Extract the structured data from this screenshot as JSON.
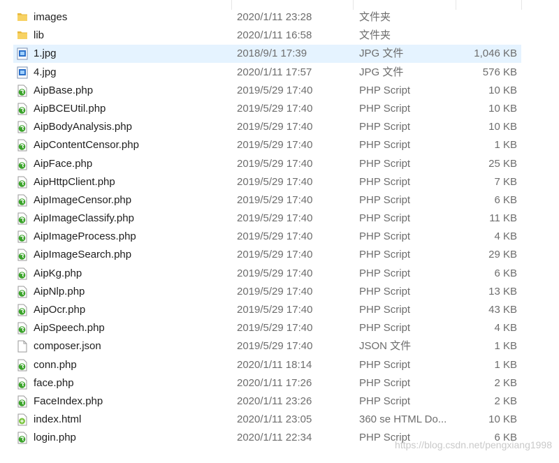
{
  "rows": [
    {
      "name": "images",
      "date": "2020/1/11 23:28",
      "type": "文件夹",
      "size": "",
      "icon": "folder-icon"
    },
    {
      "name": "lib",
      "date": "2020/1/11 16:58",
      "type": "文件夹",
      "size": "",
      "icon": "folder-icon"
    },
    {
      "name": "1.jpg",
      "date": "2018/9/1 17:39",
      "type": "JPG 文件",
      "size": "1,046 KB",
      "icon": "jpg-file-icon",
      "selected": true
    },
    {
      "name": "4.jpg",
      "date": "2020/1/11 17:57",
      "type": "JPG 文件",
      "size": "576 KB",
      "icon": "jpg-file-icon"
    },
    {
      "name": "AipBase.php",
      "date": "2019/5/29 17:40",
      "type": "PHP Script",
      "size": "10 KB",
      "icon": "php-file-icon"
    },
    {
      "name": "AipBCEUtil.php",
      "date": "2019/5/29 17:40",
      "type": "PHP Script",
      "size": "10 KB",
      "icon": "php-file-icon"
    },
    {
      "name": "AipBodyAnalysis.php",
      "date": "2019/5/29 17:40",
      "type": "PHP Script",
      "size": "10 KB",
      "icon": "php-file-icon"
    },
    {
      "name": "AipContentCensor.php",
      "date": "2019/5/29 17:40",
      "type": "PHP Script",
      "size": "1 KB",
      "icon": "php-file-icon"
    },
    {
      "name": "AipFace.php",
      "date": "2019/5/29 17:40",
      "type": "PHP Script",
      "size": "25 KB",
      "icon": "php-file-icon"
    },
    {
      "name": "AipHttpClient.php",
      "date": "2019/5/29 17:40",
      "type": "PHP Script",
      "size": "7 KB",
      "icon": "php-file-icon"
    },
    {
      "name": "AipImageCensor.php",
      "date": "2019/5/29 17:40",
      "type": "PHP Script",
      "size": "6 KB",
      "icon": "php-file-icon"
    },
    {
      "name": "AipImageClassify.php",
      "date": "2019/5/29 17:40",
      "type": "PHP Script",
      "size": "11 KB",
      "icon": "php-file-icon"
    },
    {
      "name": "AipImageProcess.php",
      "date": "2019/5/29 17:40",
      "type": "PHP Script",
      "size": "4 KB",
      "icon": "php-file-icon"
    },
    {
      "name": "AipImageSearch.php",
      "date": "2019/5/29 17:40",
      "type": "PHP Script",
      "size": "29 KB",
      "icon": "php-file-icon"
    },
    {
      "name": "AipKg.php",
      "date": "2019/5/29 17:40",
      "type": "PHP Script",
      "size": "6 KB",
      "icon": "php-file-icon"
    },
    {
      "name": "AipNlp.php",
      "date": "2019/5/29 17:40",
      "type": "PHP Script",
      "size": "13 KB",
      "icon": "php-file-icon"
    },
    {
      "name": "AipOcr.php",
      "date": "2019/5/29 17:40",
      "type": "PHP Script",
      "size": "43 KB",
      "icon": "php-file-icon"
    },
    {
      "name": "AipSpeech.php",
      "date": "2019/5/29 17:40",
      "type": "PHP Script",
      "size": "4 KB",
      "icon": "php-file-icon"
    },
    {
      "name": "composer.json",
      "date": "2019/5/29 17:40",
      "type": "JSON 文件",
      "size": "1 KB",
      "icon": "generic-file-icon"
    },
    {
      "name": "conn.php",
      "date": "2020/1/11 18:14",
      "type": "PHP Script",
      "size": "1 KB",
      "icon": "php-file-icon"
    },
    {
      "name": "face.php",
      "date": "2020/1/11 17:26",
      "type": "PHP Script",
      "size": "2 KB",
      "icon": "php-file-icon"
    },
    {
      "name": "FaceIndex.php",
      "date": "2020/1/11 23:26",
      "type": "PHP Script",
      "size": "2 KB",
      "icon": "php-file-icon"
    },
    {
      "name": "index.html",
      "date": "2020/1/11 23:05",
      "type": "360 se HTML Do...",
      "size": "10 KB",
      "icon": "html-file-icon"
    },
    {
      "name": "login.php",
      "date": "2020/1/11 22:34",
      "type": "PHP Script",
      "size": "6 KB",
      "icon": "php-file-icon"
    }
  ],
  "watermark": "https://blog.csdn.net/pengxiang1998",
  "colors": {
    "selected_row": "#e5f3ff",
    "folder": "#f4c74b",
    "php_green": "#3aa32a",
    "jpg_blue": "#2a6fc9",
    "secondary_text": "#6d6d6d"
  }
}
